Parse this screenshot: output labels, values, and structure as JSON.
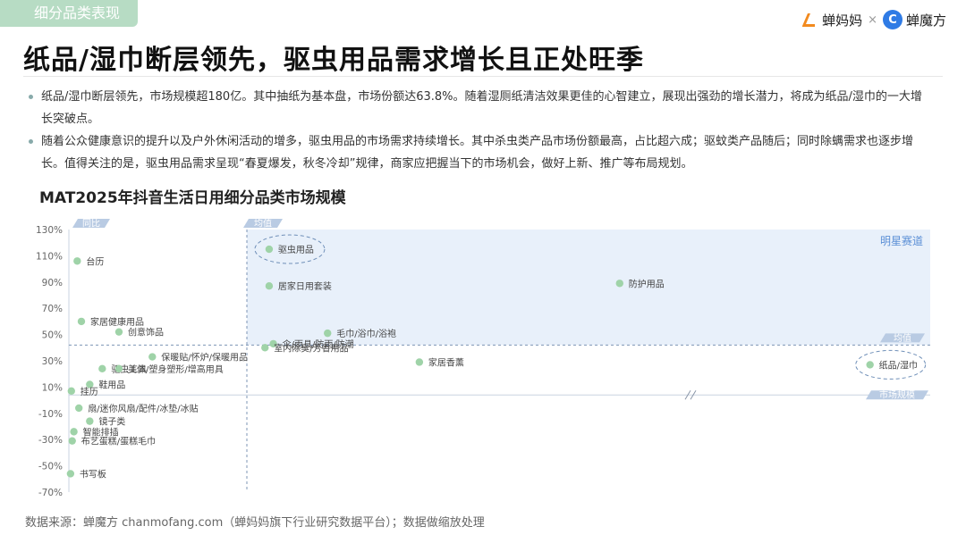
{
  "header": {
    "tag": "细分品类表现",
    "brand_left": "蝉妈妈",
    "brand_x": "×",
    "brand_right": "蝉魔方",
    "title": "纸品/湿巾断层领先，驱虫用品需求增长且正处旺季"
  },
  "bullets": [
    "纸品/湿巾断层领先，市场规模超180亿。其中抽纸为基本盘，市场份额达63.8%。随着湿厕纸清洁效果更佳的心智建立，展现出强劲的增长潜力，将成为纸品/湿巾的一大增长突破点。",
    "随着公众健康意识的提升以及户外休闲活动的增多，驱虫用品的市场需求持续增长。其中杀虫类产品市场份额最高，占比超六成；驱蚊类产品随后；同时除螨需求也逐步增长。值得关注的是，驱虫用品需求呈现“春夏爆发，秋冬冷却”规律，商家应把握当下的市场机会，做好上新、推广等布局规划。"
  ],
  "chart_title": "MAT2025年抖音生活日用细分品类市场规模",
  "source": "数据来源：蝉魔方 chanmofang.com（蝉妈妈旗下行业研究数据平台）；数据做缩放处理",
  "colors": {
    "point": "#9fd3a8",
    "axis_tag": "#b9cbe3",
    "region": "#e8f0fa",
    "accent_text": "#5b8fd6",
    "circle": "#6f8fb8"
  },
  "chart_data": {
    "type": "scatter",
    "ylim": [
      -70,
      130
    ],
    "yticks": [
      "130%",
      "110%",
      "90%",
      "70%",
      "50%",
      "30%",
      "10%",
      "-10%",
      "-30%",
      "-50%",
      "-70%"
    ],
    "ytick_values": [
      130,
      110,
      90,
      70,
      50,
      30,
      10,
      -10,
      -30,
      -50,
      -70
    ],
    "y_axis_tag": "同比",
    "x_axis_tag": "市场规模",
    "x_avg_tag": "均值",
    "y_avg_tag": "均值",
    "y_avg": 42,
    "region_label": "明星赛道",
    "points": [
      {
        "label": "台历",
        "x": 1,
        "y": 106
      },
      {
        "label": "驱虫用品",
        "x": 24,
        "y": 115,
        "highlight": true
      },
      {
        "label": "居家日用套装",
        "x": 24,
        "y": 87
      },
      {
        "label": "防护用品",
        "x": 66,
        "y": 89
      },
      {
        "label": "家居健康用品",
        "x": 1.5,
        "y": 60
      },
      {
        "label": "创意饰品",
        "x": 6,
        "y": 52
      },
      {
        "label": "毛巾/浴巾/浴袍",
        "x": 31,
        "y": 51
      },
      {
        "label": "伞/雨具/防雨/防潮",
        "x": 24.5,
        "y": 43
      },
      {
        "label": "室内除臭/芳香用品",
        "x": 23.5,
        "y": 40
      },
      {
        "label": "驱虫工具",
        "x": 4,
        "y": 24
      },
      {
        "label": "保暖贴/怀炉/保暖用品",
        "x": 10,
        "y": 33
      },
      {
        "label": "美体/塑身塑形/增高用具",
        "x": 6,
        "y": 24
      },
      {
        "label": "家居香薰",
        "x": 42,
        "y": 29
      },
      {
        "label": "纸品/湿巾",
        "x": 96,
        "y": 27,
        "highlight": true
      },
      {
        "label": "鞋用品",
        "x": 2.5,
        "y": 12
      },
      {
        "label": "挂历",
        "x": 0.3,
        "y": 7
      },
      {
        "label": "扇/迷你风扇/配件/冰垫/冰贴",
        "x": 1.2,
        "y": -6
      },
      {
        "label": "镜子类",
        "x": 2.5,
        "y": -16
      },
      {
        "label": "智能排插",
        "x": 0.6,
        "y": -24
      },
      {
        "label": "布艺蛋糕/蛋糕毛巾",
        "x": 0.4,
        "y": -31
      },
      {
        "label": "书写板",
        "x": 0.2,
        "y": -56
      }
    ]
  }
}
